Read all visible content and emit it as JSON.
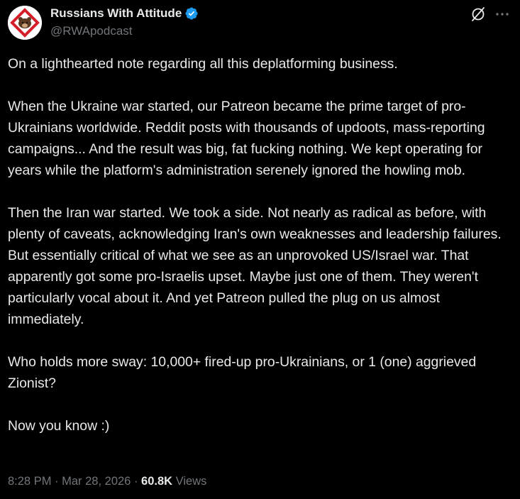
{
  "author": {
    "display_name": "Russians With Attitude",
    "handle": "@RWApodcast",
    "verified": true,
    "verified_color": "#1d9bf0"
  },
  "icons": {
    "avatar": "bear-logo-avatar",
    "verified": "verified-badge-icon",
    "grok": "grok-icon",
    "more": "more-options-icon"
  },
  "tweet": {
    "paragraphs": [
      "On a lighthearted note regarding all this deplatforming business.",
      "When the Ukraine war started, our Patreon became the prime target of pro-Ukrainians worldwide. Reddit posts with thousands of updoots, mass-reporting campaigns... And the result was big, fat fucking nothing. We kept operating for years while the platform's administration serenely ignored the howling mob.",
      "Then the Iran war started. We took a side. Not nearly as radical as before, with plenty of caveats, acknowledging Iran's own weaknesses and leadership failures. But essentially critical of what we see as an unprovoked US/Israel war. That apparently got some pro-Israelis upset. Maybe just one of them. They weren't particularly vocal about it. And yet Patreon pulled the plug on us almost immediately.",
      "Who holds more sway: 10,000+ fired-up pro-Ukrainians, or 1 (one) aggrieved Zionist?",
      "Now you know :)"
    ]
  },
  "meta": {
    "time": "8:28 PM",
    "separator": " · ",
    "date": "Mar 28, 2026",
    "views_count": "60.8K",
    "views_label": " Views"
  },
  "colors": {
    "background": "#000000",
    "text_primary": "#e7e9ea",
    "text_secondary": "#71767b",
    "accent": "#1d9bf0"
  }
}
